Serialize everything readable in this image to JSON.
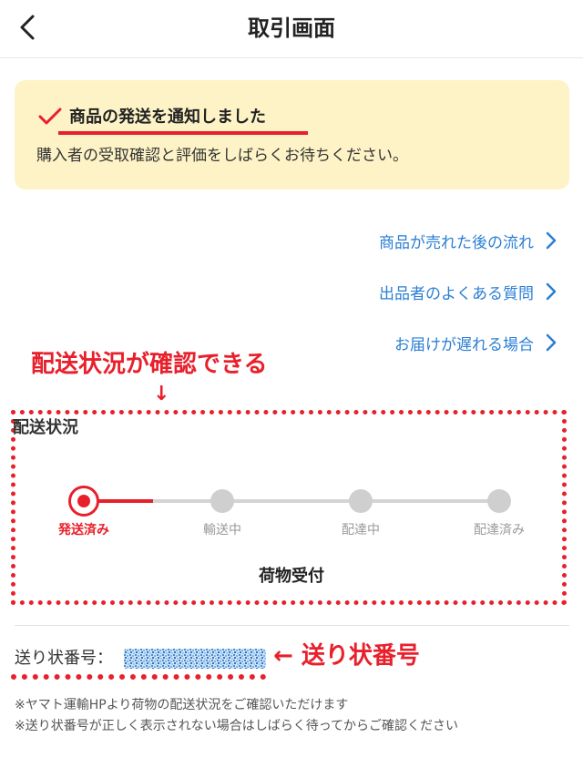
{
  "header": {
    "title": "取引画面"
  },
  "notice": {
    "title": "商品の発送を通知しました",
    "body": "購入者の受取確認と評価をしばらくお待ちください。"
  },
  "links": [
    {
      "label": "商品が売れた後の流れ"
    },
    {
      "label": "出品者のよくある質問"
    },
    {
      "label": "お届けが遅れる場合"
    }
  ],
  "annotations": {
    "status_caption": "配送状況が確認できる",
    "down_arrow": "↓",
    "tracking_caption": "← 送り状番号"
  },
  "delivery": {
    "heading": "配送状況",
    "steps": [
      {
        "label": "発送済み",
        "active": true
      },
      {
        "label": "輸送中",
        "active": false
      },
      {
        "label": "配達中",
        "active": false
      },
      {
        "label": "配達済み",
        "active": false
      }
    ],
    "current_status": "荷物受付"
  },
  "tracking": {
    "label": "送り状番号："
  },
  "notes": [
    "※ヤマト運輸HPより荷物の配送状況をご確認いただけます",
    "※送り状番号が正しく表示されない場合はしばらく待ってからご確認ください"
  ],
  "colors": {
    "accent_red": "#e8202c",
    "link_blue": "#2a7fd4",
    "notice_bg": "#fdf3c6",
    "inactive_gray": "#cfcfcf"
  }
}
